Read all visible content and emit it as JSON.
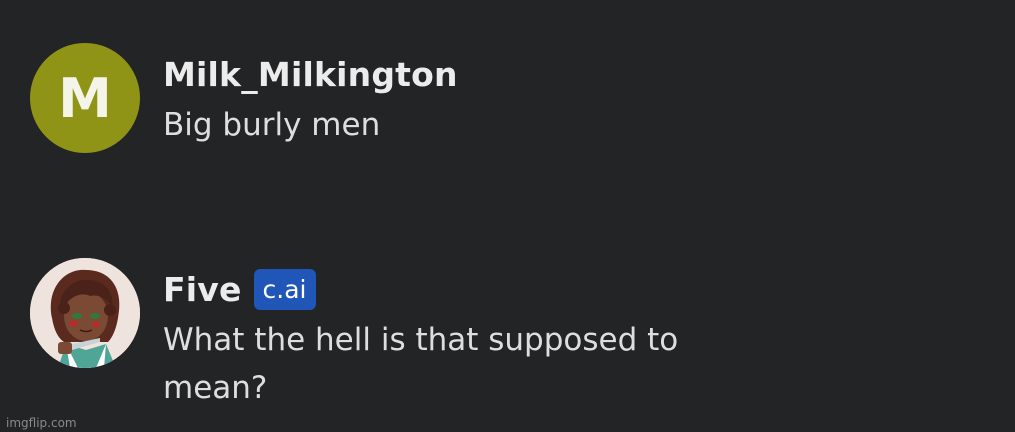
{
  "messages": [
    {
      "avatar_letter": "M",
      "avatar_color": "#8f9417",
      "username": "Milk_Milkington",
      "text": "Big burly men"
    },
    {
      "avatar_icon": "character-portrait",
      "username": "Five",
      "badge": "c.ai",
      "badge_color": "#1f56b7",
      "text": "What the hell is that supposed to mean?"
    }
  ],
  "watermark": "imgflip.com"
}
